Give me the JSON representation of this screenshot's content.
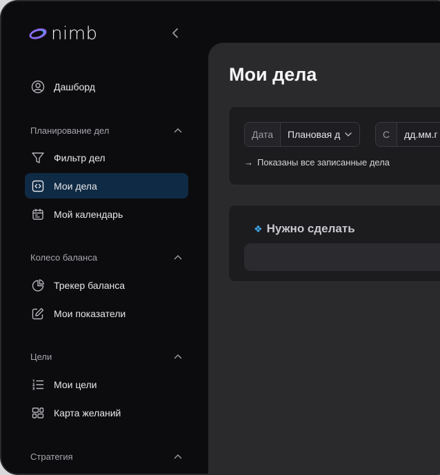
{
  "app": {
    "logo_text": "nimb"
  },
  "sidebar": {
    "dashboard": "Дашборд",
    "sections": [
      {
        "title": "Планирование дел",
        "items": [
          "Фильтр дел",
          "Мои дела",
          "Мой календарь"
        ]
      },
      {
        "title": "Колесо баланса",
        "items": [
          "Трекер баланса",
          "Мои показатели"
        ]
      },
      {
        "title": "Цели",
        "items": [
          "Мои цели",
          "Карта желаний"
        ]
      },
      {
        "title": "Стратегия",
        "items": []
      }
    ],
    "active_item": "Мои дела"
  },
  "main": {
    "title": "Мои дела",
    "filter": {
      "date_label": "Дата",
      "date_type": "Плановая д",
      "from_label": "С",
      "from_placeholder": "дд.мм.г",
      "hint_arrow": "→",
      "hint": "Показаны все записанные дела"
    },
    "todo": {
      "icon": "❖",
      "title": "Нужно сделать"
    }
  },
  "colors": {
    "active_bg": "#0f2a44",
    "accent": "#3fa7e8",
    "logo_purple": "#8b6cf0"
  }
}
